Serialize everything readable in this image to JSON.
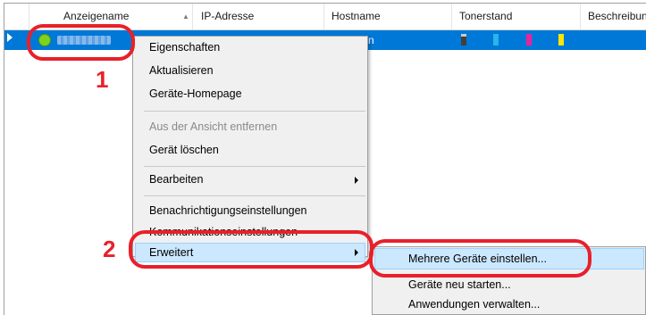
{
  "table": {
    "columns": [
      {
        "label": "Anzeigename"
      },
      {
        "label": "IP-Adresse"
      },
      {
        "label": "Hostname"
      },
      {
        "label": "Tonerstand"
      },
      {
        "label": "Beschreibung"
      }
    ],
    "selected_row": {
      "status": "online",
      "trailing_text": "n",
      "toner_colors": [
        "#404040",
        "#29b5e8",
        "#e8239b",
        "#ffe600"
      ]
    }
  },
  "context_menu": {
    "items": [
      {
        "label": "Eigenschaften",
        "enabled": true
      },
      {
        "label": "Aktualisieren",
        "enabled": true
      },
      {
        "label": "Geräte-Homepage",
        "enabled": true
      },
      {
        "label": "Aus der Ansicht entfernen",
        "enabled": false
      },
      {
        "label": "Gerät löschen",
        "enabled": true
      },
      {
        "label": "Bearbeiten",
        "enabled": true,
        "submenu": true
      },
      {
        "label": "Benachrichtigungseinstellungen",
        "enabled": true
      },
      {
        "label": "Kommunikationseinstellungen",
        "enabled": true
      },
      {
        "label": "Erweitert",
        "enabled": true,
        "submenu": true,
        "highlighted": true
      }
    ]
  },
  "submenu": {
    "items": [
      {
        "label": "Mehrere Geräte einstellen...",
        "highlighted": true
      },
      {
        "label": "Geräte neu starten..."
      },
      {
        "label": "Anwendungen verwalten..."
      }
    ]
  },
  "annotations": {
    "step1": "1",
    "step2": "2",
    "color": "#e8202a"
  }
}
